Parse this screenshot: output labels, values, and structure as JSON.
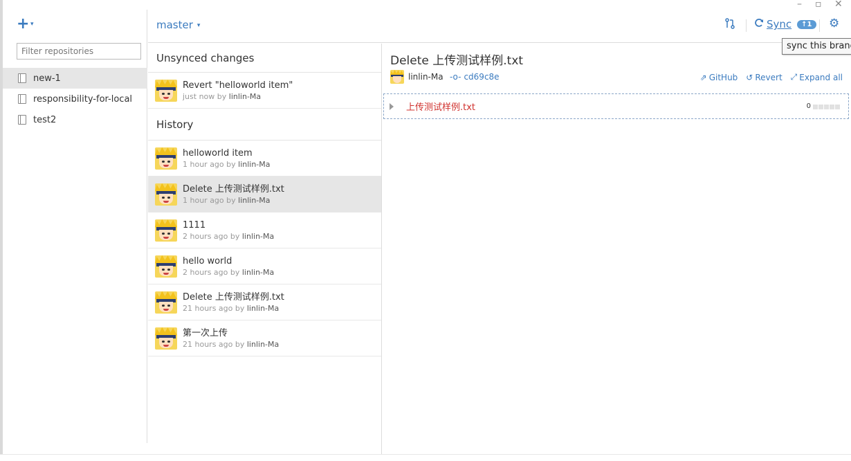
{
  "window": {
    "minimize": "–",
    "maximize": "▫",
    "close": "✕"
  },
  "sidebar": {
    "add_label": "+",
    "add_caret": "▾",
    "filter_placeholder": "Filter repositories",
    "repos": [
      {
        "name": "new-1",
        "active": true
      },
      {
        "name": "responsibility-for-local",
        "active": false
      },
      {
        "name": "test2",
        "active": false
      }
    ]
  },
  "topbar": {
    "branch": "master",
    "branch_caret": "▾",
    "sync_label": "Sync",
    "sync_badge": "↑1",
    "tooltip": "sync this branch"
  },
  "history": {
    "unsynced_title": "Unsynced changes",
    "history_title": "History",
    "by": "by",
    "unsynced": [
      {
        "title": "Revert \"helloworld item\"",
        "time": "just now",
        "author": "linlin-Ma"
      }
    ],
    "commits": [
      {
        "title": "helloworld item",
        "time": "1 hour ago",
        "author": "linlin-Ma",
        "selected": false
      },
      {
        "title": "Delete 上传测试样例.txt",
        "time": "1 hour ago",
        "author": "linlin-Ma",
        "selected": true
      },
      {
        "title": "1111",
        "time": "2 hours ago",
        "author": "linlin-Ma",
        "selected": false
      },
      {
        "title": "hello world",
        "time": "2 hours ago",
        "author": "linlin-Ma",
        "selected": false
      },
      {
        "title": "Delete 上传测试样例.txt",
        "time": "21 hours ago",
        "author": "linlin-Ma",
        "selected": false
      },
      {
        "title": "第一次上传",
        "time": "21 hours ago",
        "author": "linlin-Ma",
        "selected": false
      }
    ]
  },
  "detail": {
    "title": "Delete 上传测试样例.txt",
    "author": "linlin-Ma",
    "sha": "cd69c8e",
    "actions": {
      "github": "GitHub",
      "revert": "Revert",
      "expand": "Expand all"
    },
    "file": {
      "name": "上传测试样例.txt",
      "count": "0"
    }
  },
  "colors": {
    "accent": "#3b7bbf",
    "deleted_file": "#d0312d",
    "selected_bg": "#e6e6e6"
  }
}
